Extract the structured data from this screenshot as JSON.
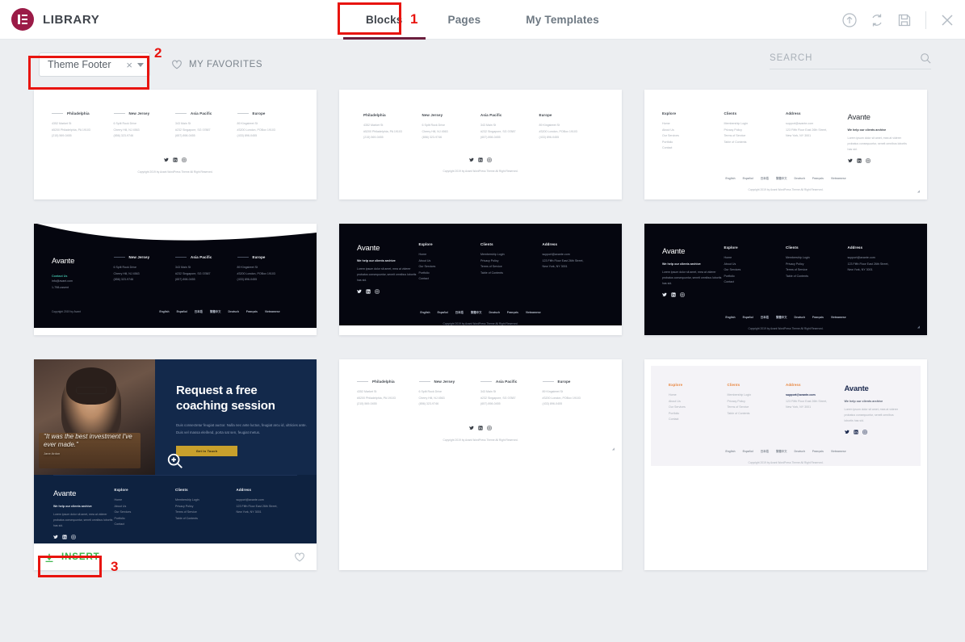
{
  "header": {
    "brand_title": "LIBRARY",
    "logo_icon": "elementor-logo-icon",
    "tabs": [
      {
        "label": "Blocks",
        "active": true
      },
      {
        "label": "Pages",
        "active": false
      },
      {
        "label": "My Templates",
        "active": false
      }
    ],
    "actions": [
      {
        "name": "import-template-icon",
        "title": "Import Template"
      },
      {
        "name": "sync-library-icon",
        "title": "Sync Library"
      },
      {
        "name": "save-icon",
        "title": "Save"
      },
      {
        "name": "close-icon",
        "title": "Close"
      }
    ],
    "accent_active_underline": "#6b1f3e",
    "logo_color": "#9b1b47"
  },
  "filter_bar": {
    "category_select": {
      "value": "Theme Footer",
      "clear_label": "×",
      "caret_icon": "chevron-down-icon"
    },
    "favorites": {
      "label": "MY FAVORITES",
      "icon": "heart-outline-icon"
    },
    "search": {
      "placeholder": "SEARCH",
      "value": "",
      "icon": "search-icon"
    }
  },
  "annotations": [
    {
      "number": "1",
      "target": "blocks-tab",
      "color": "#e8140f"
    },
    {
      "number": "2",
      "target": "category-select",
      "color": "#e8140f"
    },
    {
      "number": "3",
      "target": "insert-button",
      "color": "#e8140f"
    }
  ],
  "card_actions": {
    "insert_label": "INSERT",
    "insert_icon": "download-icon",
    "insert_color": "#39b54a",
    "favorite_icon": "heart-outline-icon",
    "zoom_icon": "magnifier-plus-icon"
  },
  "footer_preview_common": {
    "brand": "Avante",
    "tagline": "We help our clients archive",
    "body": "Lorem ipsum dolor sit amet, mea at viderer probatus consequuntur, seneit omnibus lobortis has sid.",
    "contact_heading": "Contact Us",
    "contact_email": "info@avant.com",
    "contact_phone": "1-798-ussent",
    "explore": {
      "heading": "Explore",
      "items": [
        "Home",
        "About Us",
        "Our Services",
        "Portfolio",
        "Contact"
      ]
    },
    "clients": {
      "heading": "Clients",
      "items": [
        "Membership Login",
        "Privacy Policy",
        "Terms of Service",
        "Table of Contents"
      ]
    },
    "address": {
      "heading": "Address",
      "items": [
        "support@avante.com",
        "123 Fifth Floor East 26th Street,",
        "New York, NY 3001"
      ]
    },
    "offices": [
      {
        "city": "Philadelphia",
        "lines": [
          "4352 Market St",
          "#5200 Philadelphia, PA 19103",
          "(215) 569-0455"
        ]
      },
      {
        "city": "New Jersey",
        "lines": [
          "6 Split Rock Drive",
          "Cherry Hill, NJ 4563",
          "(856) 323-9746"
        ]
      },
      {
        "city": "Asia Pacific",
        "lines": [
          "343 Main St",
          "#232 Singapore, SG 07887",
          "(657) 898-0455"
        ]
      },
      {
        "city": "Europe",
        "lines": [
          "89 Kingstreet St",
          "#3200 London, POBox 19103",
          "(433) 896-0455"
        ]
      }
    ],
    "languages": [
      "English",
      "Español",
      "日本語",
      "繁體中文",
      "Deutsch",
      "Français",
      "Vietnamese"
    ],
    "copyright": "Copyright 2019 by Avant WordPress Theme All Right Reserved.",
    "copyright_short": "Copyright 2019 by Avant",
    "socials": [
      "twitter-icon",
      "linkedin-icon",
      "instagram-icon"
    ]
  },
  "hero_card": {
    "title_line1": "Request a free",
    "title_line2": "coaching session",
    "paragraph": "Duis consectetur feugiat auctor. Nulla nec ante luctus, feugiat arcu id, ultricies ante. Duis vel massa eleifend, porta sat sen, feugiat metus.",
    "button_label": "Get In Touch",
    "quote": "\"It was the best investment I've ever made.\"",
    "quote_author": "Jane Ardon"
  },
  "cards": [
    {
      "id": 1,
      "variant": "light",
      "layout": "offices"
    },
    {
      "id": 2,
      "variant": "light",
      "layout": "offices"
    },
    {
      "id": 3,
      "variant": "light",
      "layout": "columns"
    },
    {
      "id": 4,
      "variant": "dark",
      "layout": "wave-offices"
    },
    {
      "id": 5,
      "variant": "dark",
      "layout": "columns"
    },
    {
      "id": 6,
      "variant": "dark",
      "layout": "columns"
    },
    {
      "id": 7,
      "variant": "navy",
      "layout": "hero-columns",
      "hovered": true
    },
    {
      "id": 8,
      "variant": "light",
      "layout": "offices"
    },
    {
      "id": 9,
      "variant": "cream",
      "layout": "columns"
    }
  ]
}
